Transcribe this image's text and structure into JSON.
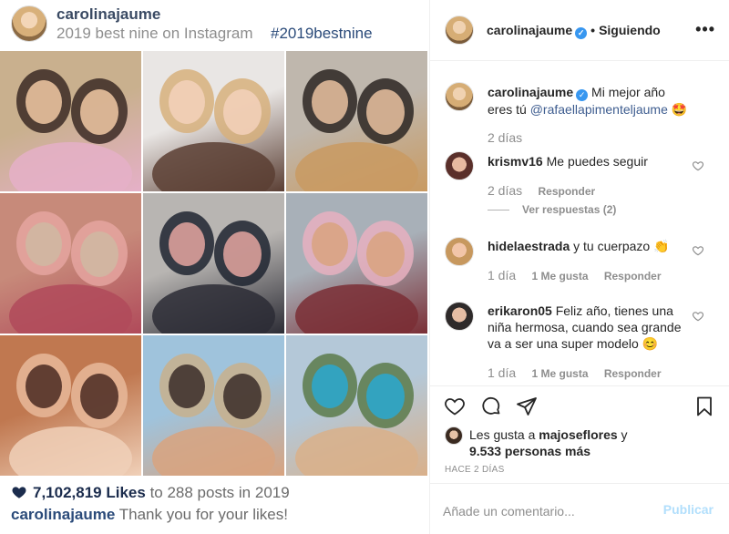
{
  "post": {
    "username": "carolinajaume",
    "subtitle": "2019 best nine on Instagram",
    "hashtag": "#2019bestnine",
    "likes_count": "7,102,819 Likes",
    "likes_suffix": "to 288 posts in 2019",
    "caption_user": "carolinajaume",
    "caption_text": "Thank you for your likes!"
  },
  "photos": [
    {
      "name": "photo-1",
      "colors": [
        "#c9b08e",
        "#3b2a25",
        "#f1c9a5",
        "#e5b0c8"
      ]
    },
    {
      "name": "photo-2",
      "colors": [
        "#e9e6e4",
        "#d7b07c",
        "#f3d1bb",
        "#5a3e33"
      ]
    },
    {
      "name": "photo-3",
      "colors": [
        "#bfb7ad",
        "#2c2622",
        "#e9c2a0",
        "#c99a61"
      ]
    },
    {
      "name": "photo-4",
      "colors": [
        "#c78a7a",
        "#e5a5a0",
        "#cfb8a2",
        "#b04a5a"
      ]
    },
    {
      "name": "photo-5",
      "colors": [
        "#b8b5b2",
        "#1f2530",
        "#e4a6a0",
        "#2c2c35"
      ]
    },
    {
      "name": "photo-6",
      "colors": [
        "#a8b0b8",
        "#e8b0bf",
        "#d9a37f",
        "#7a2e35"
      ]
    },
    {
      "name": "photo-7",
      "colors": [
        "#c07850",
        "#e8b89a",
        "#4a2a22",
        "#f0d0b8"
      ]
    },
    {
      "name": "photo-8",
      "colors": [
        "#9fc3dc",
        "#c8b08c",
        "#3a2c28",
        "#d8a37f"
      ]
    },
    {
      "name": "photo-9",
      "colors": [
        "#b4c8d8",
        "#5a7a4a",
        "#2aa8d0",
        "#d9b08a"
      ]
    }
  ],
  "sidebar": {
    "username": "carolinajaume",
    "dot": "•",
    "follow_state": "Siguiendo",
    "more": "•••"
  },
  "comments": [
    {
      "user": "carolinajaume",
      "text": "Mi mejor año eres tú ",
      "mention": "@rafaellapimenteljaume",
      "emoji": "🤩",
      "date": "2 días"
    },
    {
      "user": "krismv16",
      "text": "Me puedes seguir",
      "date": "2 días",
      "reply": "Responder",
      "view_replies": "Ver respuestas (2)"
    },
    {
      "user": "hidelaestrada",
      "text": "y tu cuerpazo",
      "emoji": "👏",
      "date": "1 día",
      "likes": "1 Me gusta",
      "reply": "Responder"
    },
    {
      "user": "erikaron05",
      "text": "Feliz año, tienes una niña hermosa, cuando sea grande va a ser una super modelo",
      "emoji": "😊",
      "date": "1 día",
      "likes": "1 Me gusta",
      "reply": "Responder"
    }
  ],
  "liked_by": {
    "prefix": "Les gusta a",
    "user": "majoseflores",
    "suffix_mid": " y",
    "count": "9.533 personas más"
  },
  "time_ago": "HACE 2 DÍAS",
  "add_comment": {
    "placeholder": "Añade un comentario...",
    "publish": "Publicar"
  },
  "colors": {
    "link": "#2b4b7a",
    "verified": "#3897f0",
    "publish_disabled": "#b2dffc"
  }
}
